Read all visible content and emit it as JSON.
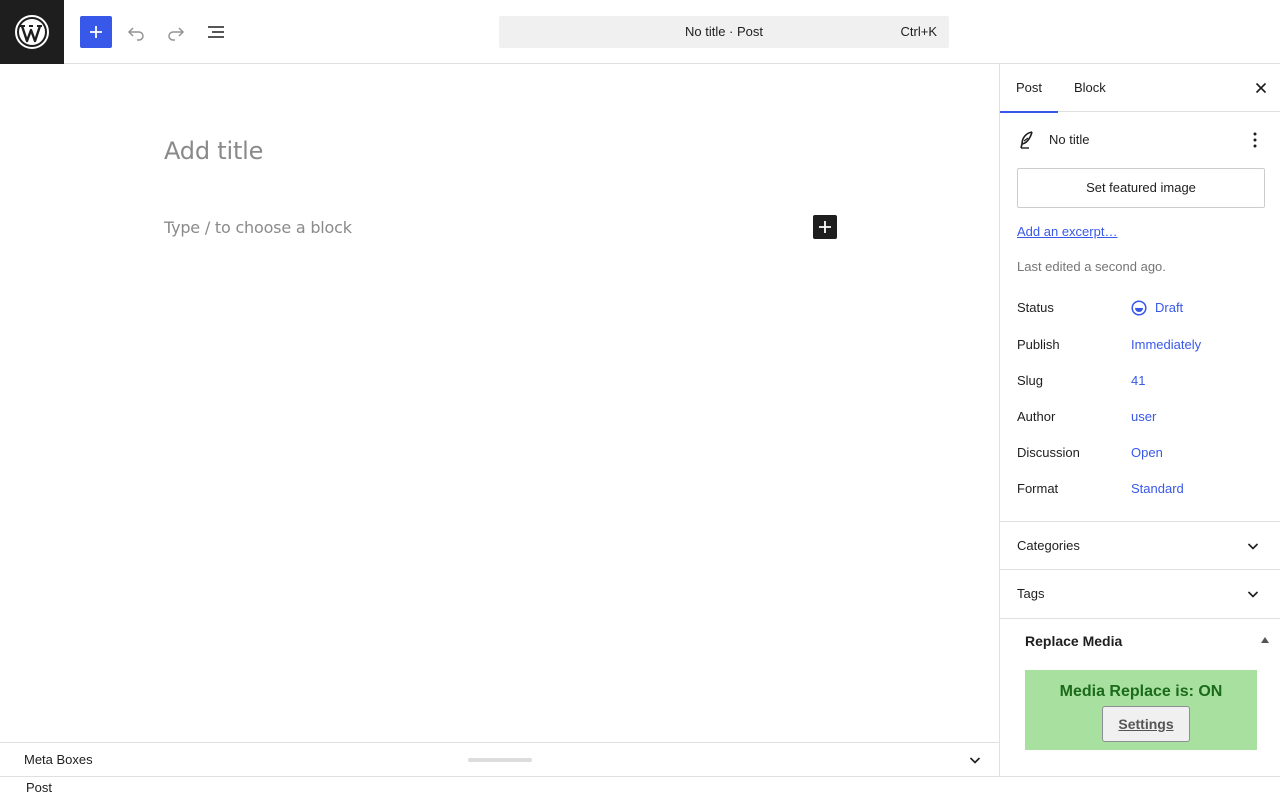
{
  "header": {
    "command_title": "No title · Post",
    "command_shortcut": "Ctrl+K"
  },
  "editor": {
    "title_placeholder": "Add title",
    "block_placeholder": "Type / to choose a block"
  },
  "meta_boxes": {
    "label": "Meta Boxes"
  },
  "footer": {
    "breadcrumb": "Post"
  },
  "sidebar": {
    "tabs": [
      {
        "label": "Post"
      },
      {
        "label": "Block"
      }
    ],
    "summary": {
      "title": "No title",
      "featured_image_label": "Set featured image",
      "excerpt_link": "Add an excerpt…",
      "last_edited": "Last edited a second ago."
    },
    "properties": [
      {
        "label": "Status",
        "value": "Draft"
      },
      {
        "label": "Publish",
        "value": "Immediately"
      },
      {
        "label": "Slug",
        "value": "41"
      },
      {
        "label": "Author",
        "value": "user"
      },
      {
        "label": "Discussion",
        "value": "Open"
      },
      {
        "label": "Format",
        "value": "Standard"
      }
    ],
    "panels": [
      {
        "label": "Categories"
      },
      {
        "label": "Tags"
      }
    ],
    "replace_media": {
      "title": "Replace Media",
      "status": "Media Replace is:  ON",
      "settings_label": "Settings"
    }
  },
  "colors": {
    "accent": "#3858e9",
    "dark": "#1e1e1e",
    "replace_bg": "#a8e0a0",
    "replace_text": "#1b6b1b"
  }
}
